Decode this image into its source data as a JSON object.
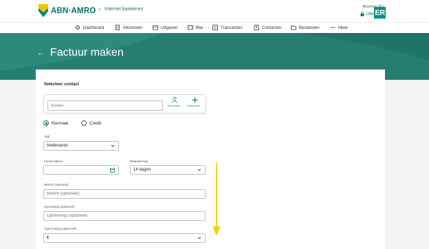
{
  "header": {
    "logo_text": "ABN·AMRO",
    "back_link": "Internet bankieren",
    "company": "Bloemen BV",
    "logout": "Uitloggen",
    "avatar_initials": "ER"
  },
  "nav": {
    "items": [
      {
        "label": "Dashboard",
        "icon": "gear-icon"
      },
      {
        "label": "Inkomsten",
        "icon": "document-icon"
      },
      {
        "label": "Uitgaven",
        "icon": "wallet-icon"
      },
      {
        "label": "Btw",
        "icon": "tax-icon"
      },
      {
        "label": "Transacties",
        "icon": "list-icon"
      },
      {
        "label": "Contacten",
        "icon": "contact-icon"
      },
      {
        "label": "Bestanden",
        "icon": "folder-icon"
      },
      {
        "label": "Meer",
        "icon": "more-icon"
      }
    ]
  },
  "page": {
    "title": "Factuur maken"
  },
  "form": {
    "section_title": "Selecteer contact",
    "search_placeholder": "Zoeken",
    "show_contacts_label": "Toon conta...",
    "add_contact_label": "Voeg conta...",
    "radio_normal": "Normaal",
    "radio_credit": "Credit",
    "radio_selected": "Normaal",
    "language_label": "Taal",
    "language_value": "Nederlands",
    "invoice_date_label": "Factuurdatum",
    "invoice_date_value": "",
    "payment_term_label": "Betaaltermijn",
    "payment_term_value": "14 dagen",
    "subject_label": "Betreft (optioneel)",
    "subject_placeholder": "Betreft (optioneel)",
    "remark_label": "Opmerking (optioneel)",
    "remark_placeholder": "Opmerking (optioneel)",
    "discount_label": "Type korting (optioneel)",
    "discount_value": "€"
  },
  "colors": {
    "brand": "#00716b",
    "hero": "#267e73",
    "annotation_arrow": "#f2d21a"
  }
}
